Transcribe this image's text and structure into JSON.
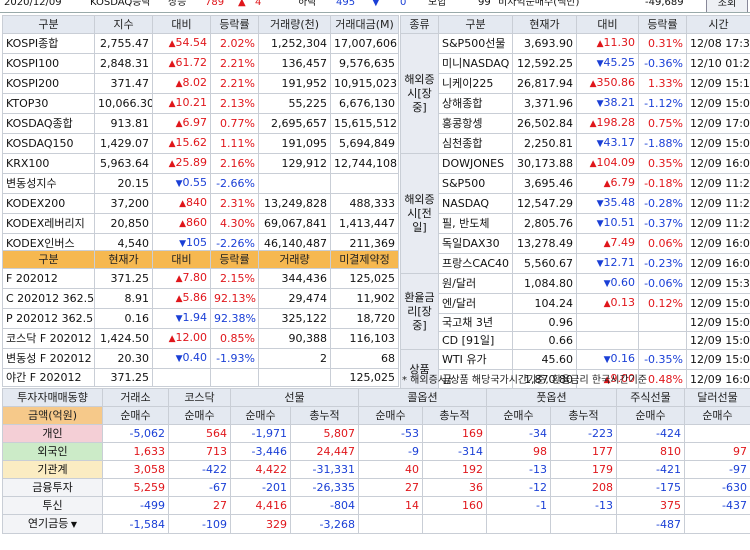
{
  "topbar": {
    "date": "2020/12/09",
    "market": "KOSDAQ등락",
    "up_label": "상승",
    "up_count": "789",
    "up_limit": "4",
    "down_label": "하락",
    "down_count": "495",
    "down_limit": "0",
    "flat_label": "보합",
    "flat_count": "99",
    "arb_label": "비차익순매수(백만)",
    "arb_value": "-49,689",
    "query_button": "조회"
  },
  "index_table": {
    "headers": [
      "구분",
      "지수",
      "대비",
      "등락률",
      "거래량(천)",
      "거래대금(M)"
    ],
    "rows": [
      {
        "name": "KOSPI종합",
        "value": "2,755.47",
        "dir": "up",
        "diff": "54.54",
        "rate": "2.02%",
        "vol": "1,252,304",
        "amt": "17,007,606"
      },
      {
        "name": "KOSPI100",
        "value": "2,848.31",
        "dir": "up",
        "diff": "61.72",
        "rate": "2.21%",
        "vol": "136,457",
        "amt": "9,576,635"
      },
      {
        "name": "KOSPI200",
        "value": "371.47",
        "dir": "up",
        "diff": "8.02",
        "rate": "2.21%",
        "vol": "191,952",
        "amt": "10,915,023"
      },
      {
        "name": "KTOP30",
        "value": "10,066.30",
        "dir": "up",
        "diff": "10.21",
        "rate": "2.13%",
        "vol": "55,225",
        "amt": "6,676,130"
      },
      {
        "name": "KOSDAQ종합",
        "value": "913.81",
        "dir": "up",
        "diff": "6.97",
        "rate": "0.77%",
        "vol": "2,695,657",
        "amt": "15,615,512"
      },
      {
        "name": "KOSDAQ150",
        "value": "1,429.07",
        "dir": "up",
        "diff": "15.62",
        "rate": "1.11%",
        "vol": "191,095",
        "amt": "5,694,849"
      },
      {
        "name": "KRX100",
        "value": "5,963.64",
        "dir": "up",
        "diff": "25.89",
        "rate": "2.16%",
        "vol": "129,912",
        "amt": "12,744,108"
      },
      {
        "name": "변동성지수",
        "value": "20.15",
        "dir": "down",
        "diff": "0.55",
        "rate": "-2.66%",
        "vol": "",
        "amt": ""
      },
      {
        "name": "KODEX200",
        "value": "37,200",
        "dir": "up",
        "diff": "840",
        "rate": "2.31%",
        "vol": "13,249,828",
        "amt": "488,333"
      },
      {
        "name": "KODEX레버리지",
        "value": "20,850",
        "dir": "up",
        "diff": "860",
        "rate": "4.30%",
        "vol": "69,067,841",
        "amt": "1,413,447"
      },
      {
        "name": "KODEX인버스",
        "value": "4,540",
        "dir": "down",
        "diff": "105",
        "rate": "-2.26%",
        "vol": "46,140,487",
        "amt": "211,369"
      }
    ]
  },
  "futures_table": {
    "headers": [
      "구분",
      "현재가",
      "대비",
      "등락률",
      "거래량",
      "미결제약정"
    ],
    "rows": [
      {
        "name": "F 202012",
        "value": "371.25",
        "dir": "up",
        "diff": "7.80",
        "rate": "2.15%",
        "vol": "344,436",
        "oi": "125,025"
      },
      {
        "name": "C 202012 362.5",
        "value": "8.91",
        "dir": "up",
        "diff": "5.86",
        "rate": "92.13%",
        "vol": "29,474",
        "oi": "11,902"
      },
      {
        "name": "P 202012 362.5",
        "value": "0.16",
        "dir": "down",
        "diff": "1.94",
        "rate": "92.38%",
        "vol": "325,122",
        "oi": "18,720"
      },
      {
        "name": "코스닥 F 202012",
        "value": "1,424.50",
        "dir": "up",
        "diff": "12.00",
        "rate": "0.85%",
        "vol": "90,388",
        "oi": "116,103"
      },
      {
        "name": "변동성 F 202012",
        "value": "20.30",
        "dir": "down",
        "diff": "0.40",
        "rate": "-1.93%",
        "vol": "2",
        "oi": "68"
      },
      {
        "name": "야간 F 202012",
        "value": "371.25",
        "dir": "",
        "diff": "",
        "rate": "",
        "vol": "",
        "oi": "125,025"
      }
    ]
  },
  "overseas_table": {
    "headers": [
      "종류",
      "구분",
      "현재가",
      "대비",
      "등락률",
      "시간"
    ],
    "groups": [
      {
        "label": "해외증시[장중]",
        "rows": [
          {
            "name": "S&P500선물",
            "value": "3,693.90",
            "dir": "up",
            "diff": "11.30",
            "rate": "0.31%",
            "time": "12/08 17:30"
          },
          {
            "name": "미니NASDAQ",
            "value": "12,592.25",
            "dir": "down",
            "diff": "45.25",
            "rate": "-0.36%",
            "time": "12/10 01:26"
          },
          {
            "name": "니케이225",
            "value": "26,817.94",
            "dir": "up",
            "diff": "350.86",
            "rate": "1.33%",
            "time": "12/09 15:15"
          },
          {
            "name": "상해종합",
            "value": "3,371.96",
            "dir": "down",
            "diff": "38.21",
            "rate": "-1.12%",
            "time": "12/09 15:01"
          },
          {
            "name": "홍콩항셍",
            "value": "26,502.84",
            "dir": "up",
            "diff": "198.28",
            "rate": "0.75%",
            "time": "12/09 17:09"
          },
          {
            "name": "심천종합",
            "value": "2,250.81",
            "dir": "down",
            "diff": "43.17",
            "rate": "-1.88%",
            "time": "12/09 15:00"
          }
        ]
      },
      {
        "label": "해외증시[전일]",
        "rows": [
          {
            "name": "DOWJONES",
            "value": "30,173.88",
            "dir": "up",
            "diff": "104.09",
            "rate": "0.35%",
            "time": "12/09 16:00"
          },
          {
            "name": "S&P500",
            "value": "3,695.46",
            "dir": "up",
            "diff": "6.79",
            "rate": "-0.18%",
            "time": "12/09 11:26"
          },
          {
            "name": "NASDAQ",
            "value": "12,547.29",
            "dir": "down",
            "diff": "35.48",
            "rate": "-0.28%",
            "time": "12/09 11:21"
          },
          {
            "name": "필, 반도체",
            "value": "2,805.76",
            "dir": "down",
            "diff": "10.51",
            "rate": "-0.37%",
            "time": "12/09 11:21"
          },
          {
            "name": "독일DAX30",
            "value": "13,278.49",
            "dir": "up",
            "diff": "7.49",
            "rate": "0.06%",
            "time": "12/09 16:00"
          },
          {
            "name": "프랑스CAC40",
            "value": "5,560.67",
            "dir": "down",
            "diff": "12.71",
            "rate": "-0.23%",
            "time": "12/09 16:00"
          }
        ]
      },
      {
        "label": "환율금리[장중]",
        "rows": [
          {
            "name": "원/달러",
            "value": "1,084.80",
            "dir": "down",
            "diff": "0.60",
            "rate": "-0.06%",
            "time": "12/09 15:30"
          },
          {
            "name": "엔/달러",
            "value": "104.24",
            "dir": "up",
            "diff": "0.13",
            "rate": "0.12%",
            "time": "12/09 15:00"
          },
          {
            "name": "국고채 3년",
            "value": "0.96",
            "dir": "",
            "diff": "",
            "rate": "",
            "time": "12/09 15:00"
          },
          {
            "name": "CD [91일]",
            "value": "0.66",
            "dir": "",
            "diff": "",
            "rate": "",
            "time": "12/09 15:00"
          }
        ]
      },
      {
        "label": "상품",
        "rows": [
          {
            "name": "WTI 유가",
            "value": "45.60",
            "dir": "down",
            "diff": "0.16",
            "rate": "-0.35%",
            "time": "12/09 15:00"
          },
          {
            "name": "금",
            "value": "1,870.80",
            "dir": "up",
            "diff": "9.00",
            "rate": "0.48%",
            "time": "12/09 16:00"
          }
        ]
      }
    ],
    "note": "* 해외증시/상품 해당국가시간기준, 환율금리 한국시간기준"
  },
  "investor_table": {
    "title": "투자자매매동향",
    "group_headers": [
      "거래소",
      "코스닥",
      "선물",
      "콜옵션",
      "풋옵션",
      "주식선물",
      "달러선물"
    ],
    "sub_headers": [
      "금액(억원)",
      "순매수",
      "순매수",
      "순매수",
      "총누적",
      "순매수",
      "총누적",
      "순매수",
      "총누적",
      "순매수",
      "순매수"
    ],
    "rows": [
      {
        "label": "개인",
        "style": "pink",
        "cells": [
          "-5,062",
          "564",
          "-1,971",
          "5,807",
          "-53",
          "169",
          "-34",
          "-223",
          "-424",
          ""
        ]
      },
      {
        "label": "외국인",
        "style": "green",
        "cells": [
          "1,633",
          "713",
          "-3,446",
          "24,447",
          "-9",
          "-314",
          "98",
          "177",
          "810",
          "97"
        ]
      },
      {
        "label": "기관계",
        "style": "yellow",
        "cells": [
          "3,058",
          "-422",
          "4,422",
          "-31,331",
          "40",
          "192",
          "-13",
          "179",
          "-421",
          "-97"
        ]
      },
      {
        "label": "금융투자",
        "style": "plain",
        "cells": [
          "5,259",
          "-67",
          "-201",
          "-26,335",
          "27",
          "36",
          "-12",
          "208",
          "-175",
          "-630"
        ]
      },
      {
        "label": "투신",
        "style": "plain",
        "cells": [
          "-499",
          "27",
          "4,416",
          "-804",
          "14",
          "160",
          "-1",
          "-13",
          "375",
          "-437"
        ]
      },
      {
        "label": "연기금등",
        "style": "plain",
        "cells": [
          "-1,584",
          "-109",
          "329",
          "-3,268",
          "",
          "",
          "",
          "",
          "-487",
          ""
        ]
      }
    ]
  }
}
